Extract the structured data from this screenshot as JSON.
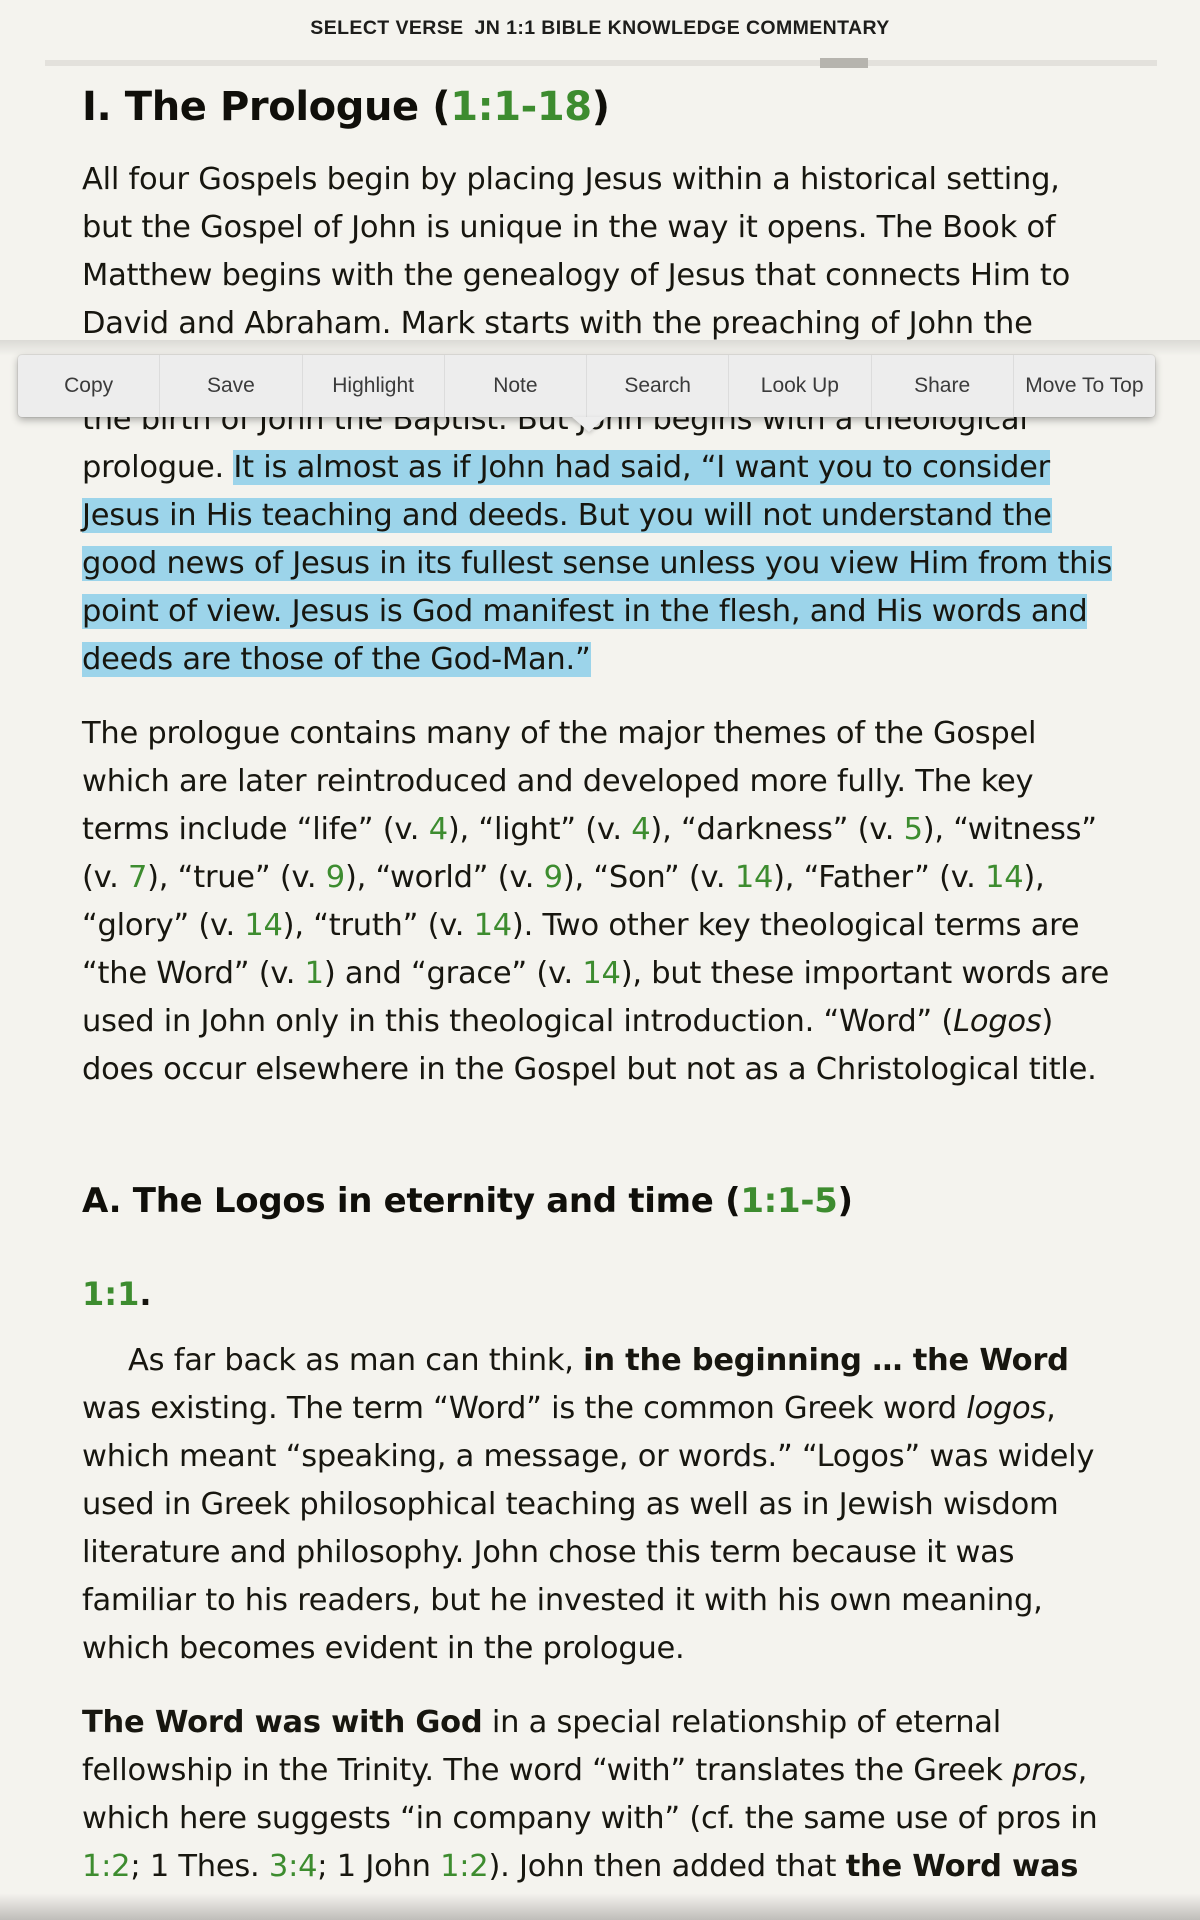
{
  "topbar": {
    "select_verse_label": "SELECT VERSE",
    "reference": "JN 1:1 BIBLE KNOWLEDGE COMMENTARY"
  },
  "scrollbar": {
    "position_percent": 70
  },
  "colors": {
    "page_background": "#f4f3ee",
    "text": "#17160f",
    "verse_link_green": "#3d8c2f",
    "highlight_blue": "#9cd4ea",
    "menu_background": "#ededed",
    "menu_text": "#3b3b3b",
    "scrollbar_track": "#e3e1dc",
    "scrollbar_thumb": "#b6b4ae"
  },
  "context_menu": {
    "items": [
      {
        "label": "Copy"
      },
      {
        "label": "Save"
      },
      {
        "label": "Highlight"
      },
      {
        "label": "Note"
      },
      {
        "label": "Search"
      },
      {
        "label": "Look Up"
      },
      {
        "label": "Share"
      },
      {
        "label": "Move To Top"
      }
    ]
  },
  "content": {
    "heading1_prefix": "I. The Prologue (",
    "heading1_ref": "1:1-18",
    "heading1_suffix": ")",
    "para1_part1": "All four Gospels begin by placing Jesus within a historical setting, but the Gospel of John is unique in the way it opens. The Book of Matthew begins with the genealogy of Jesus that connects Him to David and Abraham. Mark starts with the preaching of John the Baptist, and Luke goes back even before ",
    "para1_part2": "that with a prediction of the birth of John the Baptist. But John begins with a theological prologue. ",
    "para1_highlight": "It is almost as if John had said, “I want you to consider Jesus in His teaching and deeds. But you will not understand the good news of Jesus in its fullest sense unless you view Him from this point of view. Jesus is God manifest in the flesh, and His words and deeds are those of the God-Man.”",
    "para2_s1": "The prologue contains many of the major themes of the Gospel which are later reintroduced and developed more fully. The key terms include “life” (v. ",
    "para2_v1": "4",
    "para2_s2": "), “light” (v. ",
    "para2_v2": "4",
    "para2_s3": "), “darkness” (v. ",
    "para2_v3": "5",
    "para2_s4": "), “witness” (v. ",
    "para2_v4": "7",
    "para2_s5": "), “true” (v. ",
    "para2_v5": "9",
    "para2_s6": "), “world” (v. ",
    "para2_v6": "9",
    "para2_s7": "), “Son” (v. ",
    "para2_v7": "14",
    "para2_s8": "), “Father” (v. ",
    "para2_v8": "14",
    "para2_s9": "), “glory” (v. ",
    "para2_v9": "14",
    "para2_s10": "), “truth” (v. ",
    "para2_v10": "14",
    "para2_s11": "). Two other key theological terms are “the Word” (v. ",
    "para2_v11": "1",
    "para2_s12": ") and “grace” (v. ",
    "para2_v12": "14",
    "para2_s13": "), but these important words are used in John only in this theological introduction. “Word” (",
    "para2_logos": "Logos",
    "para2_s14": ") does occur elsewhere in the Gospel but not as a Christological title.",
    "heading2_prefix": "A. The Logos in eternity and time (",
    "heading2_ref": "1:1-5",
    "heading2_suffix": ")",
    "verse_marker": "1:1",
    "verse_marker_dot": ".",
    "para3_s1": "As far back as man can think, ",
    "para3_bold1": "in the beginning … the Word",
    "para3_s2": " was existing. The term “Word” is the common Greek word ",
    "para3_ital1": "logos",
    "para3_s3": ", which meant “speaking, a message, or words.” “Logos” was widely used in Greek philosophical teaching as well as in Jewish wisdom literature and philosophy. John chose this term because it was familiar to his readers, but he invested it with his own meaning, which becomes evident in the prologue.",
    "para4_bold1": "The Word was with God",
    "para4_s1": " in a special relationship of eternal fellowship in the Trinity. The word “with” translates the Greek ",
    "para4_ital1": "pros",
    "para4_s2": ", which here suggests “in company with” (cf. the same use of pros in ",
    "para4_v1": "1:2",
    "para4_s3": "; 1 Thes. ",
    "para4_v2": "3:4",
    "para4_s4": "; 1 John ",
    "para4_v3": "1:2",
    "para4_s5": "). John then added that ",
    "para4_bold2": "the Word was"
  }
}
